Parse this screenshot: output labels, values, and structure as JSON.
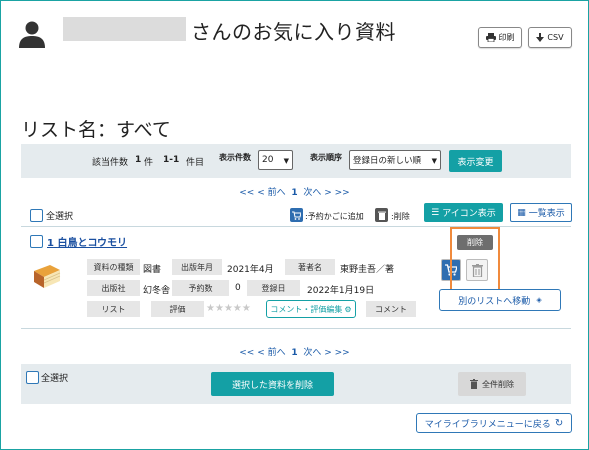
{
  "header": {
    "title": "さんのお気に入り資料",
    "print_label": "印刷",
    "csv_label": "CSV"
  },
  "list_name": "リスト名：すべて",
  "controls": {
    "count_label": "該当件数",
    "count_value": "1",
    "count_unit": "件",
    "range_value": "1-1",
    "range_unit": "件目",
    "per_page_label": "表示件数",
    "per_page_value": "20",
    "sort_label": "表示順序",
    "sort_value": "登録日の新しい順",
    "change_label": "表示変更"
  },
  "pager": {
    "first": "<<",
    "prev": "< 前へ",
    "page": "1",
    "next": "次へ >",
    "last": ">>"
  },
  "toolbar": {
    "select_all_label": "全選択",
    "cart_legend": ":予約かごに追加",
    "delete_legend": ":削除",
    "icon_view_label": "アイコン表示",
    "list_view_label": "一覧表示"
  },
  "items": [
    {
      "number": "1",
      "title": "白鳥とコウモリ",
      "fields": {
        "type_label": "資料の種類",
        "type_value": "図書",
        "date_label": "出版年月",
        "date_value": "2021年4月",
        "author_label": "著者名",
        "author_value": "東野圭吾／著",
        "publisher_label": "出版社",
        "publisher_value": "幻冬舎",
        "reserve_label": "予約数",
        "reserve_value": "0",
        "registered_label": "登録日",
        "registered_value": "2022年1月19日",
        "list_label": "リスト",
        "rating_label": "評価",
        "rating_value": 0,
        "rating_max": 5,
        "comment_edit_label": "コメント・評価編集",
        "comment_label": "コメント"
      },
      "delete_tooltip": "削除",
      "move_label": "別のリストへ移動"
    }
  ],
  "bottom": {
    "select_all_label": "全選択",
    "delete_selected_label": "選択した資料を削除",
    "delete_all_label": "全件削除",
    "back_label": "マイライブラリメニューに戻る"
  },
  "colors": {
    "accent": "#14a0a5",
    "link": "#1a5aa8",
    "highlight": "#f08a3c"
  }
}
